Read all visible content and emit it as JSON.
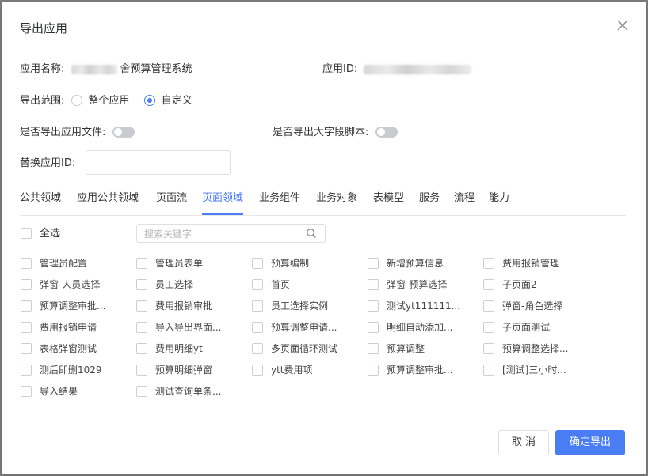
{
  "dialog": {
    "title": "导出应用"
  },
  "app_info": {
    "name_label": "应用名称:",
    "name_value_visible": "舍预算管理系统",
    "id_label": "应用ID:"
  },
  "scope": {
    "label": "导出范围:",
    "options": [
      {
        "label": "整个应用",
        "selected": false
      },
      {
        "label": "自定义",
        "selected": true
      }
    ]
  },
  "toggles": {
    "app_files_label": "是否导出应用文件:",
    "app_files_on": false,
    "big_field_label": "是否导出大字段脚本:",
    "big_field_on": false
  },
  "replace_id": {
    "label": "替换应用ID:",
    "value": ""
  },
  "tabs": [
    {
      "label": "公共领域",
      "active": false
    },
    {
      "label": "应用公共领域",
      "active": false
    },
    {
      "label": "页面流",
      "active": false
    },
    {
      "label": "页面领域",
      "active": true
    },
    {
      "label": "业务组件",
      "active": false
    },
    {
      "label": "业务对象",
      "active": false
    },
    {
      "label": "表模型",
      "active": false
    },
    {
      "label": "服务",
      "active": false
    },
    {
      "label": "流程",
      "active": false
    },
    {
      "label": "能力",
      "active": false
    }
  ],
  "select_all_label": "全选",
  "search": {
    "placeholder": "搜索关键字",
    "value": ""
  },
  "items": [
    "管理员配置",
    "管理员表单",
    "预算编制",
    "新增预算信息",
    "费用报销管理",
    "弹窗-人员选择",
    "员工选择",
    "首页",
    "弹窗-预算选择",
    "子页面2",
    "预算调整审批...",
    "费用报销审批",
    "员工选择实例",
    "测试yt111111...",
    "弹窗-角色选择",
    "费用报销申请",
    "导入导出界面...",
    "预算调整申请...",
    "明细自动添加...",
    "子页面测试",
    "表格弹窗测试",
    "费用明细yt",
    "多页面循环测试",
    "预算调整",
    "预算调整选择...",
    "测后即删1029",
    "预算明细弹窗",
    "ytt费用项",
    "预算调整审批...",
    "[测试]三小时...",
    "导入结果",
    "测试查询单条..."
  ],
  "buttons": {
    "cancel": "取 消",
    "confirm": "确定导出"
  },
  "colors": {
    "accent": "#4a7cf3",
    "border": "#dcdfe6",
    "switch_off": "#c9cbd0"
  }
}
